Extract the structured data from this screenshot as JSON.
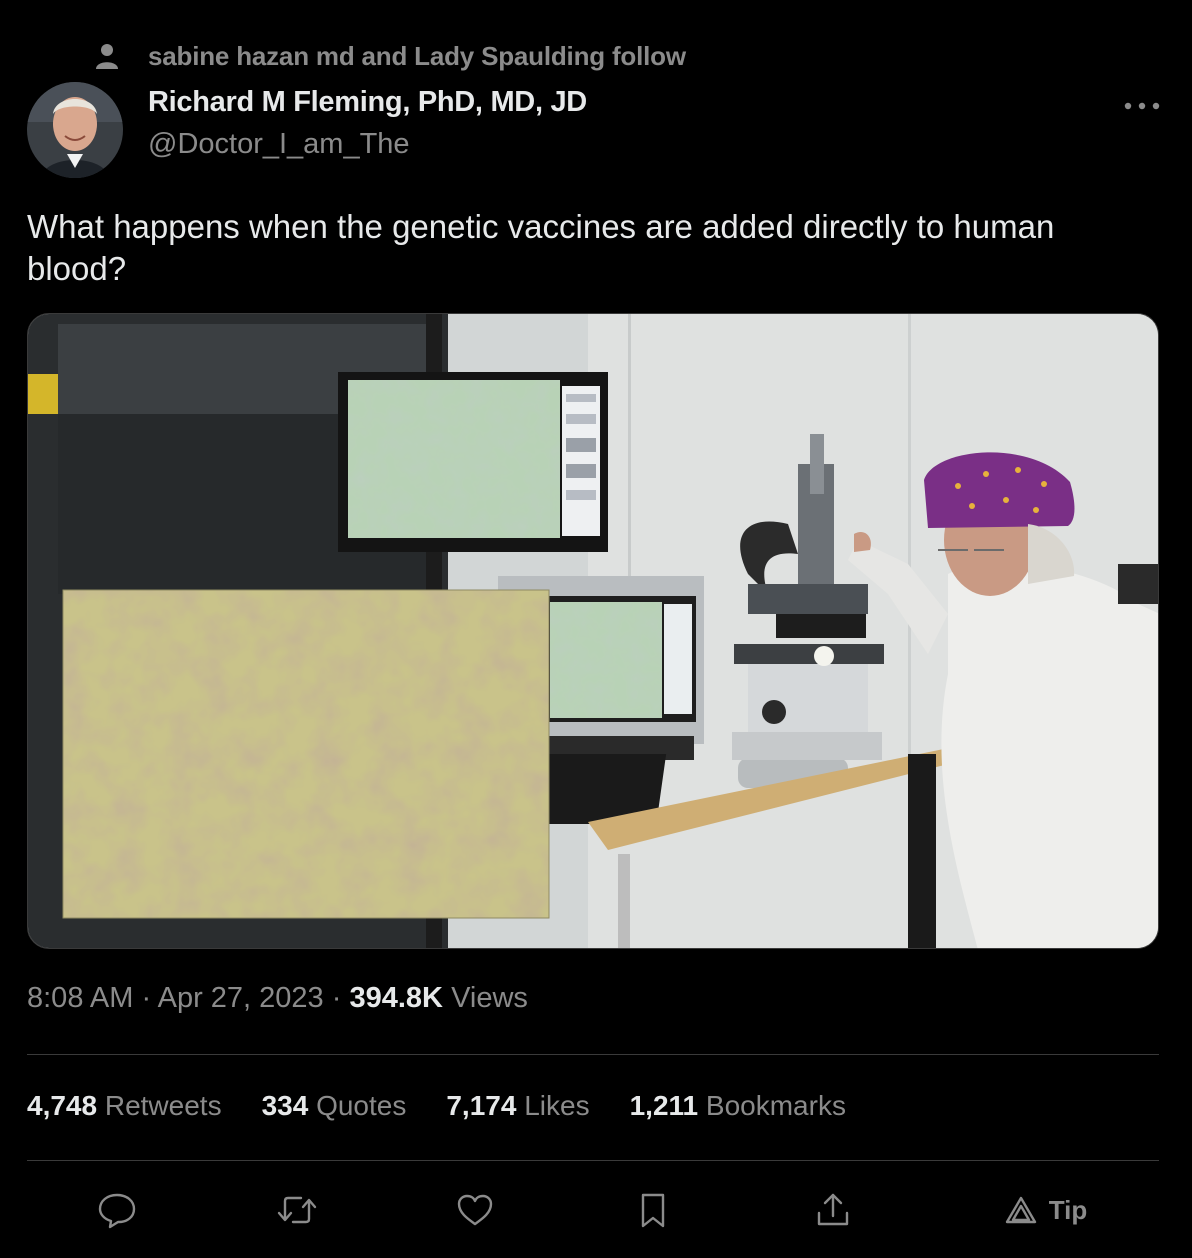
{
  "social_context": {
    "icon": "person-icon",
    "text": "sabine hazan md and Lady Spaulding follow"
  },
  "author": {
    "name": "Richard M Fleming, PhD, MD, JD",
    "handle": "@Doctor_I_am_The"
  },
  "tweet": {
    "text": "What happens when the genetic vaccines are added directly to human blood?"
  },
  "meta": {
    "time": "8:08 AM",
    "separator": "·",
    "date": "Apr 27, 2023",
    "views_count": "394.8K",
    "views_label": "Views"
  },
  "stats": [
    {
      "count": "4,748",
      "label": "Retweets"
    },
    {
      "count": "334",
      "label": "Quotes"
    },
    {
      "count": "7,174",
      "label": "Likes"
    },
    {
      "count": "1,211",
      "label": "Bookmarks"
    }
  ],
  "actions": {
    "reply": "reply-icon",
    "retweet": "retweet-icon",
    "like": "heart-icon",
    "bookmark": "bookmark-icon",
    "share": "share-icon",
    "tip_icon": "triangle-icon",
    "tip_label": "Tip"
  },
  "colors": {
    "background": "#000000",
    "primary_text": "#e7e9ea",
    "secondary_text": "#8b8b8b",
    "divider": "#3a3a3a"
  }
}
